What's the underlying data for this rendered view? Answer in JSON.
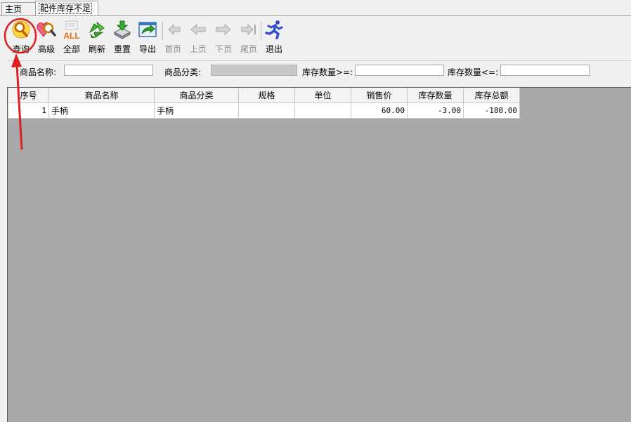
{
  "tabs": [
    {
      "label": "主页"
    },
    {
      "label": "配件库存不足"
    }
  ],
  "toolbar": {
    "query": "查询",
    "advanced": "高级",
    "all": "全部",
    "refresh": "刷新",
    "reset": "重置",
    "export": "导出",
    "first": "首页",
    "prev": "上页",
    "next": "下页",
    "last": "尾页",
    "exit": "退出"
  },
  "filter": {
    "name_label": "商品名称:",
    "name_value": "",
    "category_label": "商品分类:",
    "category_value": "",
    "qty_ge_label": "库存数量>=:",
    "qty_ge_value": "",
    "qty_le_label": "库存数量<=:",
    "qty_le_value": ""
  },
  "grid": {
    "columns": [
      "序号",
      "商品名称",
      "商品分类",
      "规格",
      "单位",
      "销售价",
      "库存数量",
      "库存总额"
    ],
    "rows": [
      [
        "1",
        "手柄",
        "手柄",
        "",
        "",
        "60.00",
        "-3.00",
        "-180.00"
      ]
    ]
  },
  "colors": {
    "annotation": "#e02020",
    "grid_background": "#a8a8a8"
  },
  "icons": {
    "query": "magnifier-icon",
    "advanced": "heart-magnifier-icon",
    "all": "all-icon",
    "refresh": "recycle-icon",
    "reset": "drive-icon",
    "export": "export-arrow-icon",
    "first": "first-page-icon",
    "prev": "prev-page-icon",
    "next": "next-page-icon",
    "last": "last-page-icon",
    "exit": "running-man-icon"
  }
}
